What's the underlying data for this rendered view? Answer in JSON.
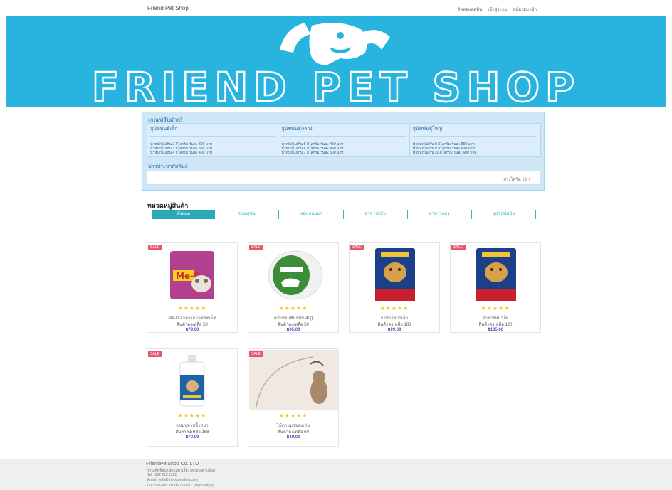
{
  "nav": {
    "brand": "Friend Pet Shop",
    "links": [
      "ติดต่อแอดมิน",
      "เข้าสู่ระบบ",
      "สมัครสมาชิก"
    ]
  },
  "banner": {
    "title": "FRIEND PET SHOP"
  },
  "notice": {
    "title": "เกณฑ์รับฝาก!",
    "columns": [
      {
        "head": "สุนัขพันธุ์เล็ก",
        "lines": [
          "น้ำหนักไม่เกิน 2 กิโลกรัม วันละ 300 บาท",
          "น้ำหนักไม่เกิน 3 กิโลกรัม วันละ 350 บาท",
          "น้ำหนักไม่เกิน 4 กิโลกรัม วันละ 400 บาท"
        ]
      },
      {
        "head": "สุนัขพันธุ์กลาง",
        "lines": [
          "น้ำหนักไม่เกิน 5 กิโลกรัม วันละ 450 บาท",
          "น้ำหนักไม่เกิน 6 กิโลกรัม วันละ 450 บาท",
          "น้ำหนักไม่เกิน 7 กิโลกรัม วันละ 500 บาท"
        ]
      },
      {
        "head": "สุนัขพันธุ์ใหญ่",
        "lines": [
          "น้ำหนักไม่เกิน 8 กิโลกรัม วันละ 550 บาท",
          "น้ำหนักไม่เกิน 9 กิโลกรัม วันละ 600 บาท",
          "น้ำหนักไม่เกิน 20 กิโลกรัม วันละ 600 บาท"
        ]
      }
    ],
    "news_title": "ข่าวประชาสัมพันธ์",
    "news_text": "ช่วงโควิด 19 ร"
  },
  "categories": {
    "title": "หมวดหมู่สินค้า",
    "tabs": [
      "ทั้งหมด",
      "ขนมสุนัข",
      "ของเล่นแมว",
      "อาหารสุนัข",
      "อาหารแมว",
      "อุปกรณ์สุนัข"
    ]
  },
  "products": [
    {
      "badge": "SALE",
      "stars": "★★★★★",
      "name": "Me-O อาหารแมวชนิดเม็ด",
      "stock": "สินค้าคงเหลือ  50",
      "price": "฿79.00",
      "image": "cat-food-bag-icon"
    },
    {
      "badge": "SALE",
      "stars": "★★★★★",
      "name": "ครีมหอมฟันสุนัข 40g",
      "stock": "สินค้าคงเหลือ  50",
      "price": "฿95.00",
      "image": "cream-jar-icon"
    },
    {
      "badge": "SALE",
      "stars": "★★★★★",
      "name": "อาหารหมาเล็ก",
      "stock": "สินค้าคงเหลือ  180",
      "price": "฿99.00",
      "image": "dog-food-bag-icon"
    },
    {
      "badge": "SALE",
      "stars": "★★★★★",
      "name": "อาหารหมาโต",
      "stock": "สินค้าคงเหลือ  120",
      "price": "฿135.00",
      "image": "dog-food-bag-icon"
    },
    {
      "badge": "SALE",
      "stars": "★★★★★",
      "name": "แชมพูอาบน้ำหมา",
      "stock": "สินค้าคงเหลือ  168",
      "price": "฿70.00",
      "image": "shampoo-bottle-icon"
    },
    {
      "badge": "SALE",
      "stars": "★★★★★",
      "name": "ไม้ตกแมวของเล่น",
      "stock": "สินค้าคงเหลือ  50",
      "price": "฿49.00",
      "image": "cat-toy-photo-icon"
    }
  ],
  "footer": {
    "company": "FriendPetShop Co.,LTD",
    "lines": [
      "ร้านเพ็ทช็อป เพื่อนสัตว์เลี้ยง (สาขาสัตว์เลี้ยง)",
      "Tel : 062 215 1222",
      "Email : info@friendpetshop.com",
      "เวลาเปิด-ปิด : 09:00-18:00 น. (หยุดวันหยุด)"
    ]
  },
  "colors": {
    "banner": "#29b4e0",
    "accent": "#2aa8b8",
    "sale": "#e8576c",
    "price": "#6a3fb5",
    "star": "#f5c518"
  }
}
